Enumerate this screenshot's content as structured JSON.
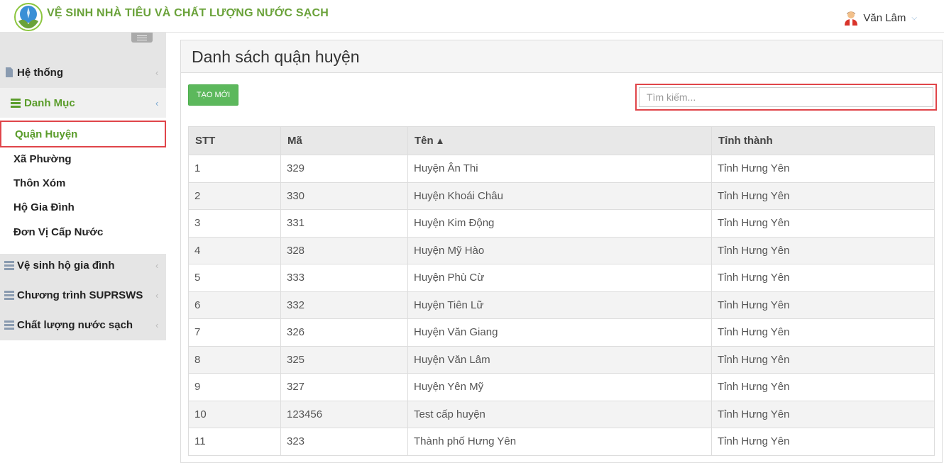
{
  "header": {
    "brand": "VỆ SINH NHÀ TIÊU VÀ CHẤT LƯỢNG NƯỚC SẠCH",
    "user_name": "Văn Lâm",
    "user_icon": "user-avatar-icon",
    "user_chevron": "⌄"
  },
  "sidebar": {
    "items": [
      {
        "label": "Hệ thống",
        "icon": "file-icon",
        "arrow": "‹"
      },
      {
        "label": "Danh Mục",
        "icon": "list-icon",
        "arrow": "‹"
      },
      {
        "label": "Vệ sinh hộ gia đình",
        "icon": "server-icon",
        "arrow": "‹"
      },
      {
        "label": "Chương trình SUPRSWS",
        "icon": "server-icon",
        "arrow": "‹"
      },
      {
        "label": "Chất lượng nước sạch",
        "icon": "server-icon",
        "arrow": "‹"
      }
    ],
    "submenu": [
      {
        "label": "Quận Huyện"
      },
      {
        "label": "Xã Phường"
      },
      {
        "label": "Thôn Xóm"
      },
      {
        "label": "Hộ Gia Đình"
      },
      {
        "label": "Đơn Vị Cấp Nước"
      }
    ]
  },
  "main": {
    "title": "Danh sách quận huyện",
    "create_label": "TẠO MỚI",
    "search_placeholder": "Tìm kiếm...",
    "columns": [
      "STT",
      "Mã",
      "Tên",
      "Tỉnh thành"
    ],
    "sort_icon": "⌃",
    "rows": [
      [
        "1",
        "329",
        "Huyện Ân Thi",
        "Tỉnh Hưng Yên"
      ],
      [
        "2",
        "330",
        "Huyện Khoái Châu",
        "Tỉnh Hưng Yên"
      ],
      [
        "3",
        "331",
        "Huyện Kim Động",
        "Tỉnh Hưng Yên"
      ],
      [
        "4",
        "328",
        "Huyện Mỹ Hào",
        "Tỉnh Hưng Yên"
      ],
      [
        "5",
        "333",
        "Huyện Phù Cừ",
        "Tỉnh Hưng Yên"
      ],
      [
        "6",
        "332",
        "Huyện Tiên Lữ",
        "Tỉnh Hưng Yên"
      ],
      [
        "7",
        "326",
        "Huyện Văn Giang",
        "Tỉnh Hưng Yên"
      ],
      [
        "8",
        "325",
        "Huyện Văn Lâm",
        "Tỉnh Hưng Yên"
      ],
      [
        "9",
        "327",
        "Huyện Yên Mỹ",
        "Tỉnh Hưng Yên"
      ],
      [
        "10",
        "123456",
        "Test cấp huyện",
        "Tỉnh Hưng Yên"
      ],
      [
        "11",
        "323",
        "Thành phố Hưng Yên",
        "Tỉnh Hưng Yên"
      ]
    ]
  },
  "colors": {
    "brand_green": "#6aa23a",
    "create_button": "#5cb85c",
    "highlight_red": "#e0454a"
  }
}
